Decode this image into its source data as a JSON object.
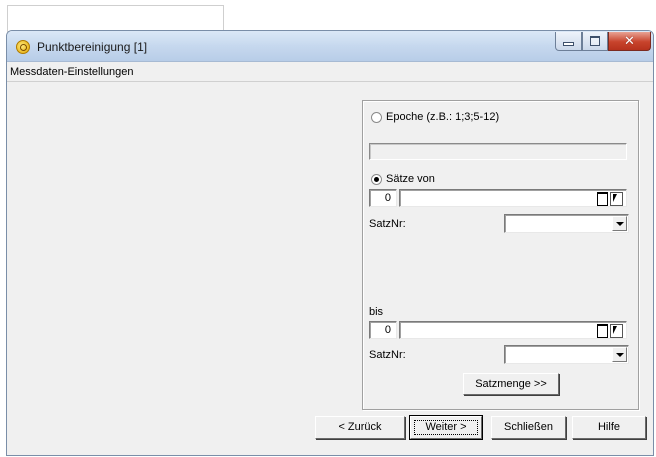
{
  "window": {
    "title": "Punktbereinigung [1]",
    "section_header": "Messdaten-Einstellungen"
  },
  "panel": {
    "epoche_label": "Epoche (z.B.: 1;3;5-12)",
    "epoche_value": "",
    "epoche_selected": false,
    "saetze_label": "Sätze von",
    "saetze_selected": true,
    "from": {
      "number": "0",
      "value": "",
      "satznr_label": "SatzNr:",
      "satznr_value": ""
    },
    "bis_label": "bis",
    "to": {
      "number": "0",
      "value": "",
      "satznr_label": "SatzNr:",
      "satznr_value": ""
    },
    "satzmenge_button": "Satzmenge >>"
  },
  "footer": {
    "back_button": "< Zurück",
    "next_button": "Weiter >",
    "close_button": "Schließen",
    "help_button": "Hilfe"
  }
}
